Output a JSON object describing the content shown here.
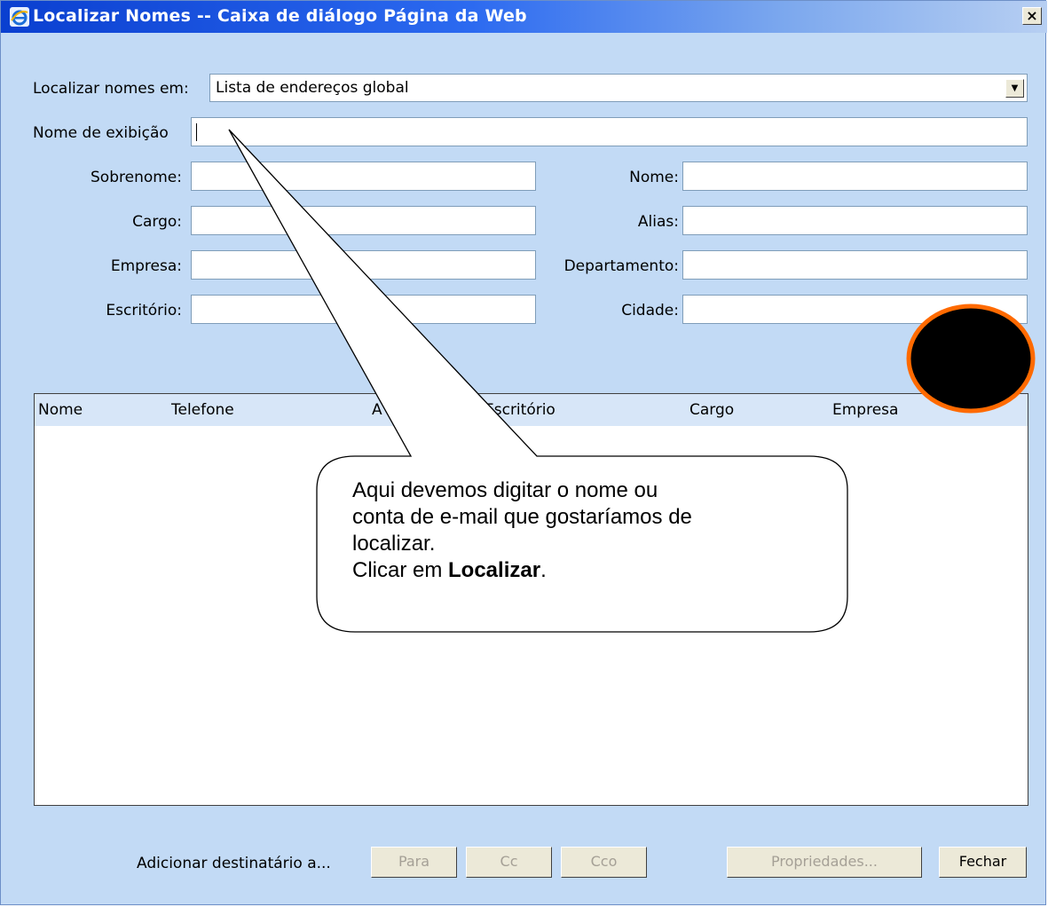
{
  "window": {
    "title": "Localizar Nomes -- Caixa de diálogo Página da Web",
    "close_glyph": "×",
    "accent_color": "#0a3fd0",
    "background_color": "#c2daf5"
  },
  "search": {
    "label": "Localizar nomes em:",
    "selected": "Lista de endereços global"
  },
  "form": {
    "display_name": {
      "label": "Nome de exibição",
      "value": ""
    },
    "sobrenome": {
      "label": "Sobrenome:",
      "value": ""
    },
    "nome": {
      "label": "Nome:",
      "value": ""
    },
    "cargo": {
      "label": "Cargo:",
      "value": ""
    },
    "alias": {
      "label": "Alias:",
      "value": ""
    },
    "empresa": {
      "label": "Empresa:",
      "value": ""
    },
    "departamento": {
      "label": "Departamento:",
      "value": ""
    },
    "escritorio": {
      "label": "Escritório:",
      "value": ""
    },
    "cidade": {
      "label": "Cidade:",
      "value": ""
    }
  },
  "results": {
    "columns": [
      "Nome",
      "Telefone",
      "A",
      "Escritório",
      "Cargo",
      "Empresa"
    ]
  },
  "footer": {
    "add_label": "Adicionar destinatário a...",
    "para": "Para",
    "cc": "Cc",
    "cco": "Cco",
    "propriedades": "Propriedades...",
    "fechar": "Fechar"
  },
  "annotation": {
    "line1": "Aqui devemos digitar o nome ou",
    "line2": "conta de e-mail que gostaríamos de",
    "line3": "localizar.",
    "line4_prefix": "Clicar em ",
    "line4_bold": "Localizar",
    "line4_suffix": ".",
    "circle_fill": "#000000",
    "circle_border": "#ff6a00"
  },
  "icons": {
    "title": "ie-icon",
    "dropdown": "chevron-down-icon",
    "close": "close-icon"
  }
}
